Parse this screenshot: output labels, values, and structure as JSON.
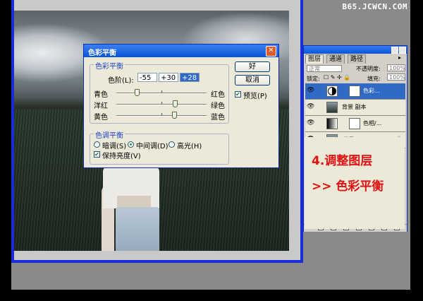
{
  "watermark": "B65.JCWCN.COM",
  "dialog": {
    "title": "色彩平衡",
    "close_glyph": "✕",
    "balance_group_label": "色彩平衡",
    "levels_label": "色阶(L):",
    "levels": [
      "-55",
      "+30",
      "+28"
    ],
    "sliders": [
      {
        "left_label": "青色",
        "right_label": "红色",
        "value": -55
      },
      {
        "left_label": "洋红",
        "right_label": "绿色",
        "value": 30
      },
      {
        "left_label": "黄色",
        "right_label": "蓝色",
        "value": 28
      }
    ],
    "tone_group_label": "色调平衡",
    "tones": [
      {
        "label": "暗调(S)",
        "selected": false
      },
      {
        "label": "中间调(D)",
        "selected": true
      },
      {
        "label": "高光(H)",
        "selected": false
      }
    ],
    "preserve_luminosity": {
      "label": "保持亮度(V)",
      "checked": true
    },
    "ok_label": "好",
    "cancel_label": "取消",
    "preview": {
      "label": "预览(P)",
      "checked": true
    },
    "accent_color": "#0a54d8"
  },
  "layers_panel": {
    "tabs": [
      "图层",
      "通道",
      "路径"
    ],
    "blend_mode": "正常",
    "opacity_label": "不透明度:",
    "opacity_value": "100%",
    "lock_label": "锁定:",
    "fill_label": "填充:",
    "fill_value": "100%",
    "layers": [
      {
        "name": "色彩...",
        "visible": true,
        "selected": true,
        "kind": "adjustment-icon"
      },
      {
        "name": "背景 副本",
        "visible": true,
        "selected": false,
        "kind": "photo"
      },
      {
        "name": "色相/...",
        "visible": true,
        "selected": false,
        "kind": "adjustment-icon"
      },
      {
        "name": "背景",
        "visible": true,
        "selected": false,
        "kind": "photo"
      }
    ]
  },
  "annotation": {
    "step": "4.调整图层",
    "subtitle": ">>  色彩平衡",
    "color": "#e21212"
  }
}
